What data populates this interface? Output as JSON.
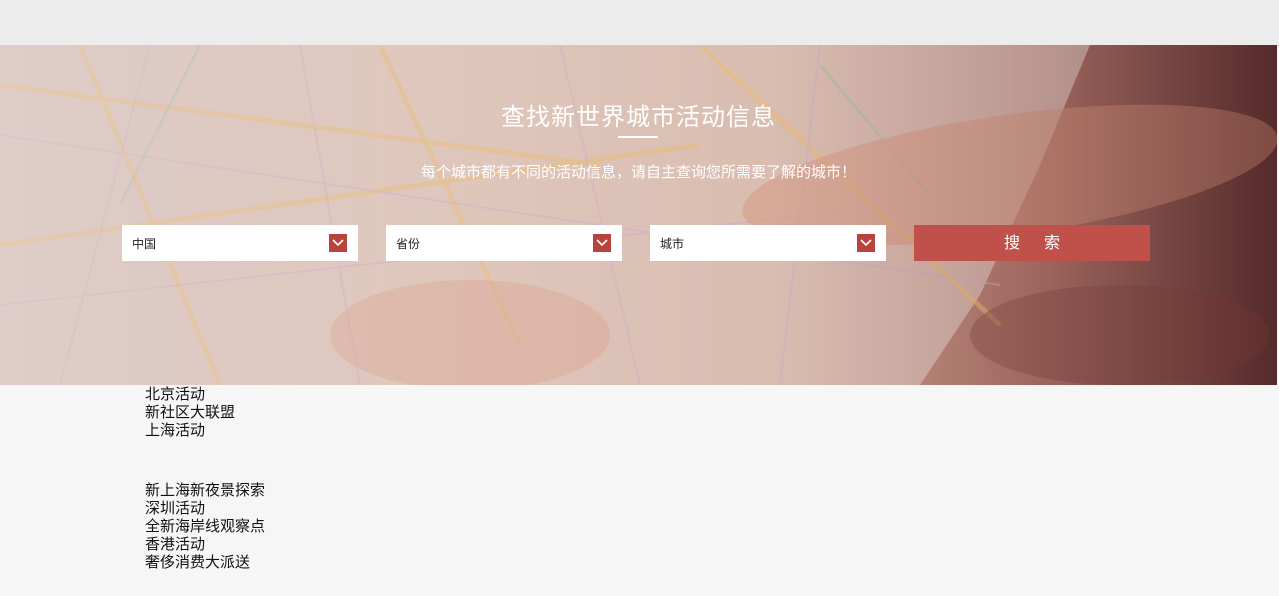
{
  "hero": {
    "title": "查找新世界城市活动信息",
    "subtitle": "每个城市都有不同的活动信息，请自主查询您所需要了解的城市！"
  },
  "filters": {
    "country": "中国",
    "province": "省份",
    "city": "城市",
    "search_label": "搜索",
    "arrow_icon": "chevron-down-icon",
    "accent_color": "#b9433c",
    "button_color": "#c0504a"
  },
  "activity_groups": [
    {
      "items": [
        "北京活动",
        "新社区大联盟",
        "上海活动"
      ]
    },
    {
      "items": [
        "新上海新夜景探索",
        "深圳活动",
        "全新海岸线观察点",
        "香港活动",
        "奢侈消费大派送"
      ]
    }
  ]
}
